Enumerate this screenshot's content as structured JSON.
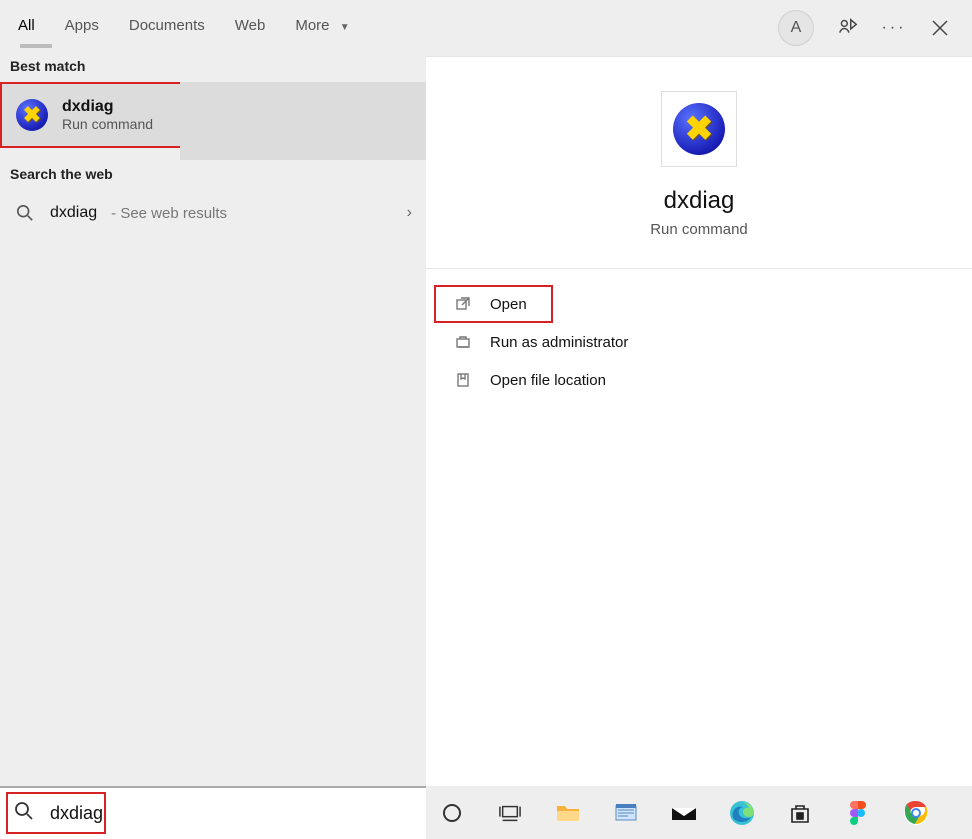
{
  "topbar": {
    "tabs": [
      "All",
      "Apps",
      "Documents",
      "Web",
      "More"
    ],
    "avatar_initial": "A"
  },
  "left_panel": {
    "best_match_header": "Best match",
    "best_match": {
      "title": "dxdiag",
      "subtitle": "Run command"
    },
    "web_header": "Search the web",
    "web_row": {
      "term": "dxdiag",
      "suffix": " - See web results"
    }
  },
  "right_panel": {
    "title": "dxdiag",
    "subtitle": "Run command",
    "actions": {
      "open": "Open",
      "run_as_admin": "Run as administrator",
      "open_location": "Open file location"
    }
  },
  "search_input": {
    "value": "dxdiag"
  }
}
